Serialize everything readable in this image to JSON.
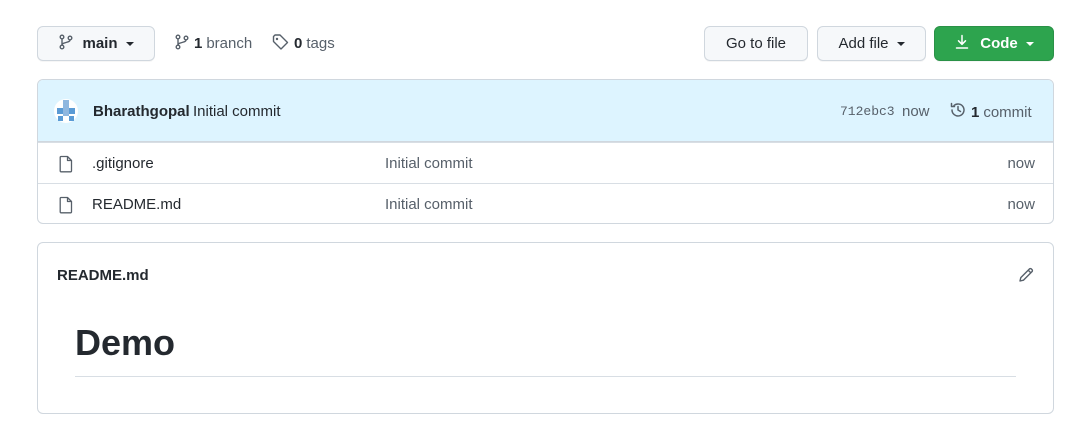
{
  "toolbar": {
    "branch_button_label": "main",
    "branch_count": "1",
    "branch_word": "branch",
    "tag_count": "0",
    "tag_word": "tags",
    "goto_file_label": "Go to file",
    "add_file_label": "Add file",
    "code_label": "Code",
    "code_button_color": "#2da44e"
  },
  "latest_commit": {
    "author": "Bharathgopal",
    "message": "Initial commit",
    "sha": "712ebc3",
    "time": "now",
    "commit_count": "1",
    "commit_word": "commit",
    "bar_color": "#ddf4ff"
  },
  "files": [
    {
      "name": ".gitignore",
      "message": "Initial commit",
      "age": "now",
      "icon": "file-icon"
    },
    {
      "name": "README.md",
      "message": "Initial commit",
      "age": "now",
      "icon": "file-icon"
    }
  ],
  "readme": {
    "filename": "README.md",
    "heading": "Demo"
  }
}
